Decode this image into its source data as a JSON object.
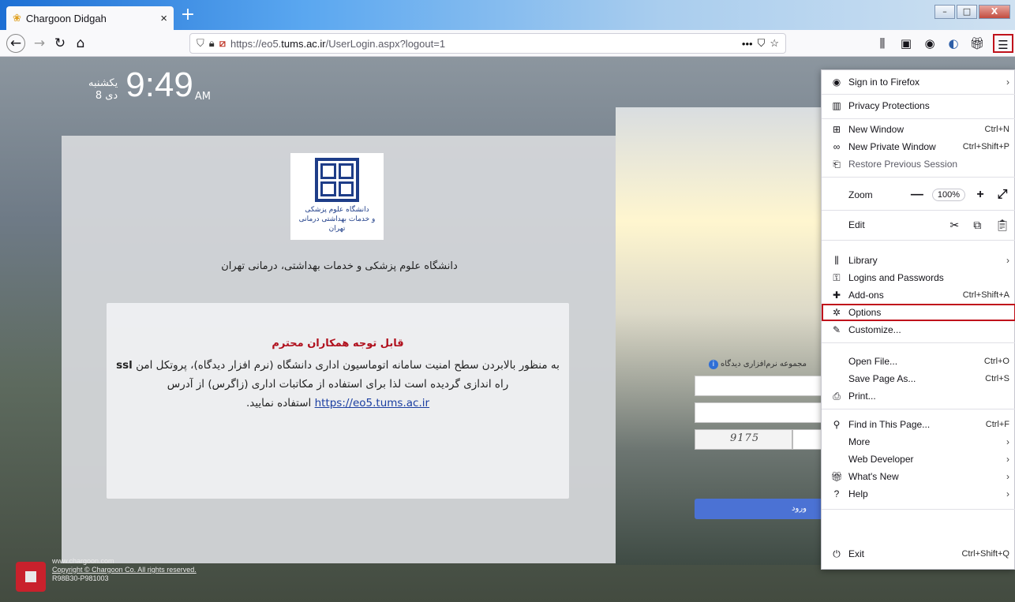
{
  "browser": {
    "tab_title": "Chargoon Didgah",
    "tab_close": "×",
    "new_tab": "+",
    "window_controls": {
      "minimize": "–",
      "maximize": "□",
      "close": "X"
    },
    "url_prefix": "https://eo5.",
    "url_domain": "tums.ac.ir",
    "url_path": "/UserLogin.aspx?logout=1",
    "page_actions": "•••"
  },
  "page": {
    "day_name": "یکشنبه",
    "date": "8 دی",
    "time": "9:49",
    "ampm": "AM",
    "logo_text_line1": "دانشگاه علوم پزشکی",
    "logo_text_line2": "و خدمات بهداشتی درمانی تهران",
    "university_name": "دانشگاه علوم پزشکی و خدمات بهداشتی، درمانی تهران",
    "notice_title": "قابل توجه همکاران محترم",
    "notice_body_1": "به منظور بالابردن سطح امنیت سامانه اتوماسیون اداری دانشگاه (نرم افزار دیدگاه)، پروتکل امن",
    "notice_ssl": "ssl",
    "notice_body_2": "راه اندازی گردیده است لذا برای استفاده از مکاتبات اداری (زاگرس) از آدرس",
    "notice_link": "https://eo5.tums.ac.ir",
    "notice_body_3": "استفاده نمایید.",
    "login_label": "مجموعه نرم‌افزاری دیدگاه",
    "captcha": "9175",
    "submit": "ورود",
    "footer_site": "www.chargoon.com",
    "footer_copyright": "Copyright © Chargoon Co. All rights reserved.",
    "footer_version": "R98B30-P981003"
  },
  "menu": {
    "sign_in": "Sign in to Firefox",
    "privacy": "Privacy Protections",
    "new_window": "New Window",
    "new_window_sc": "Ctrl+N",
    "private_window": "New Private Window",
    "private_window_sc": "Ctrl+Shift+P",
    "restore": "Restore Previous Session",
    "zoom": "Zoom",
    "zoom_minus": "—",
    "zoom_level": "100%",
    "zoom_plus": "+",
    "zoom_full": "⤢",
    "edit": "Edit",
    "library": "Library",
    "logins": "Logins and Passwords",
    "addons": "Add-ons",
    "addons_sc": "Ctrl+Shift+A",
    "options": "Options",
    "customize": "Customize...",
    "open_file": "Open File...",
    "open_file_sc": "Ctrl+O",
    "save_page": "Save Page As...",
    "save_page_sc": "Ctrl+S",
    "print": "Print...",
    "find": "Find in This Page...",
    "find_sc": "Ctrl+F",
    "more": "More",
    "web_dev": "Web Developer",
    "whats_new": "What's New",
    "help": "Help",
    "exit": "Exit",
    "exit_sc": "Ctrl+Shift+Q",
    "arrow": "›"
  },
  "colors": {
    "accent": "#1d6fd4",
    "highlight": "#c0121b",
    "submit": "#4b72d4"
  }
}
